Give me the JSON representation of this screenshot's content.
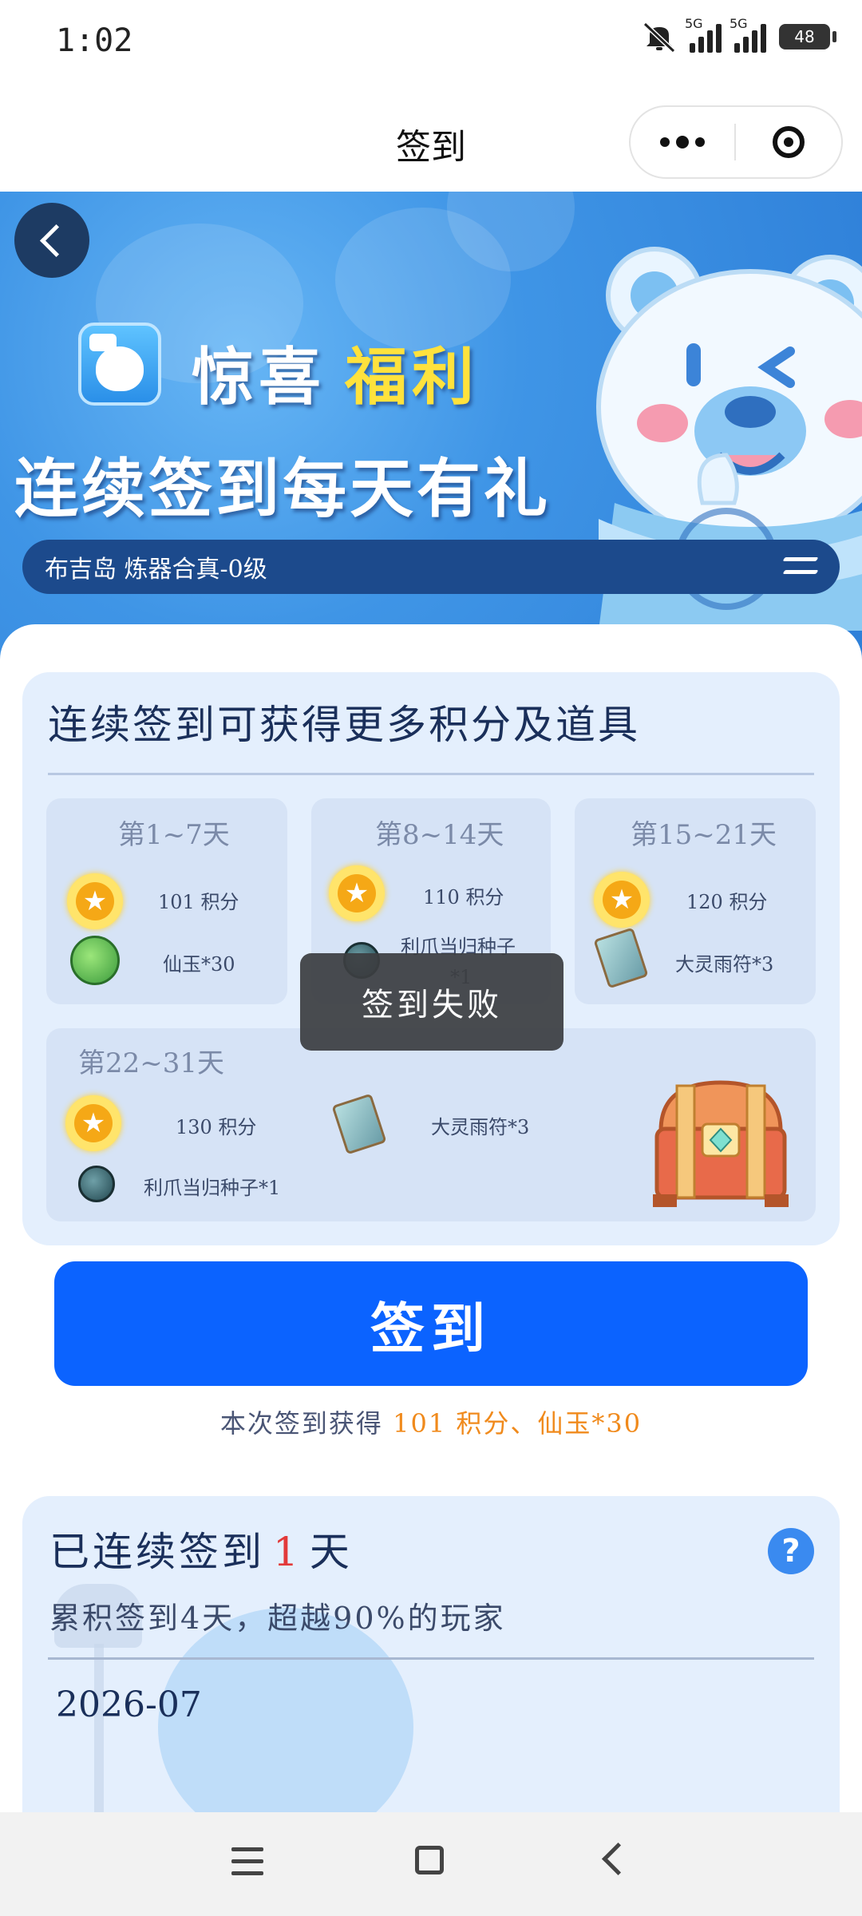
{
  "status_bar": {
    "time": "1:02",
    "network_1": "5G",
    "network_2": "5G",
    "battery": "48"
  },
  "nav": {
    "title": "签到"
  },
  "banner": {
    "title_part1": "惊喜",
    "title_part2": "福利",
    "subtitle": "连续签到每天有礼",
    "server_info": "布吉岛  炼器合真-0级"
  },
  "rewards": {
    "heading": "连续签到可获得更多积分及道具",
    "tiers": [
      {
        "title": "第1~7天",
        "items": [
          "101 积分",
          "仙玉*30"
        ]
      },
      {
        "title": "第8~14天",
        "items": [
          "110 积分",
          "利爪当归种子",
          "*1"
        ]
      },
      {
        "title": "第15~21天",
        "items": [
          "120 积分",
          "大灵雨符*3"
        ]
      },
      {
        "title": "第22~31天",
        "items": [
          "130 积分",
          "大灵雨符*3",
          "利爪当归种子*1"
        ]
      }
    ]
  },
  "toast": {
    "message": "签到失败"
  },
  "signin": {
    "button_label": "签到",
    "note_prefix": "本次签到获得",
    "note_reward": "101 积分、仙玉*30"
  },
  "streak": {
    "title_prefix": "已连续签到",
    "days": "1",
    "title_suffix": "天",
    "subtitle": "累积签到4天，超越90%的玩家",
    "help": "?",
    "month": "2026-07"
  },
  "colors": {
    "primary": "#0b63ff",
    "highlight": "#f08a1c",
    "streak_red": "#e23a3a",
    "gold": "#ffe23d"
  }
}
